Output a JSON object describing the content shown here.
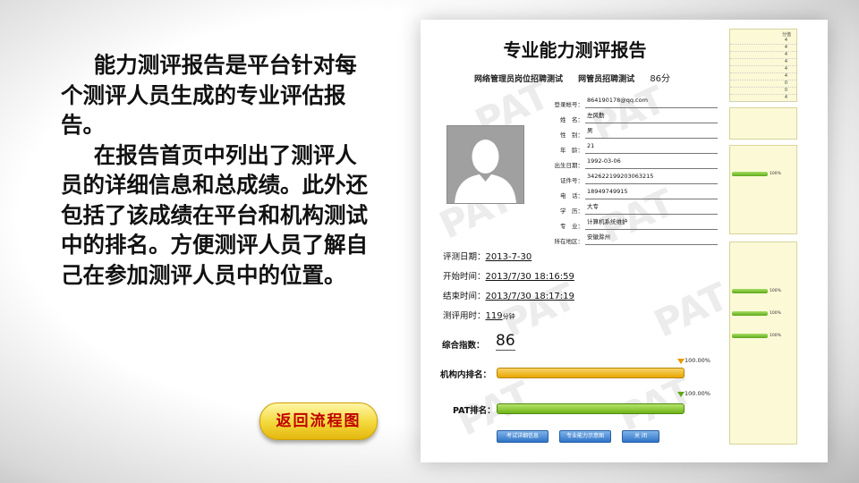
{
  "intro": {
    "para1": "能力测评报告是平台针对每个测评人员生成的专业评估报告。",
    "para2": "在报告首页中列出了测评人员的详细信息和总成绩。此外还包括了该成绩在平台和机构测试中的排名。方便测评人员了解自己在参加测评人员中的位置。"
  },
  "back_button": "返回流程图",
  "report": {
    "title": "专业能力测评报告",
    "subtitle": {
      "exam": "网络管理员岗位招聘测试",
      "paper": "网管员招聘测试",
      "score": "86分"
    },
    "watermark": "PAT",
    "fields": [
      {
        "label": "登录帐号：",
        "value": "864190178@qq.com"
      },
      {
        "label": "姓　名：",
        "value": "左风勤"
      },
      {
        "label": "性　别：",
        "value": "男"
      },
      {
        "label": "年　龄：",
        "value": "21"
      },
      {
        "label": "出生日期：",
        "value": "1992-03-06"
      },
      {
        "label": "证件号：",
        "value": "342622199203063215"
      },
      {
        "label": "电　话：",
        "value": "18949749915"
      },
      {
        "label": "学　历：",
        "value": "大专"
      },
      {
        "label": "专　业：",
        "value": "计算机系统维护"
      },
      {
        "label": "所在地区：",
        "value": "安徽滁州"
      }
    ],
    "times": [
      {
        "label": "评测日期：",
        "value": "2013-7-30",
        "unit": ""
      },
      {
        "label": "开始时间：",
        "value": "2013/7/30 18:16:59",
        "unit": ""
      },
      {
        "label": "结束时间：",
        "value": "2013/7/30 18:17:19",
        "unit": ""
      },
      {
        "label": "测评用时：",
        "value": "119",
        "unit": "分钟"
      }
    ],
    "composite_label": "综合指数：",
    "composite_value": "86",
    "org_rank_label": "机构内排名：",
    "org_rank_pct": "100.00%",
    "org_rank_fill": 1.0,
    "pat_rank_label": "PAT排名：",
    "pat_rank_pct": "100.00%",
    "pat_rank_fill": 1.0,
    "buttons": [
      "考试详细信息",
      "专业能力示意图",
      "关 闭"
    ]
  },
  "side_panel": {
    "header": "分值",
    "values": [
      "4",
      "4",
      "4",
      "4",
      "4",
      "4",
      "0",
      "0",
      "4"
    ],
    "pcts": [
      "100%",
      "100%",
      "100%",
      "100%"
    ]
  },
  "colors": {
    "accent_orange": "#e8a800",
    "accent_green": "#6fb31a",
    "button_text": "#c00000"
  }
}
